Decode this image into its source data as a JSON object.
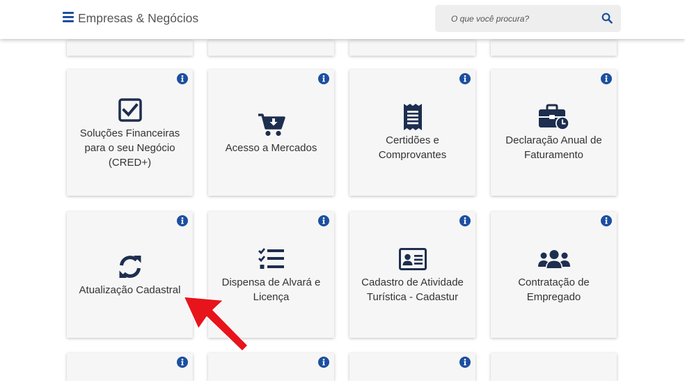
{
  "header": {
    "title": "Empresas & Negócios",
    "menu_icon": "hamburger-menu-icon",
    "search": {
      "placeholder": "O que você procura?",
      "value": "",
      "icon": "search-icon"
    }
  },
  "colors": {
    "accent": "#1c4fa0",
    "icon_dark": "#1d2e4f",
    "card_bg": "#f6f6f6",
    "search_bg": "#eeeeee",
    "annotation_arrow": "#e8141c"
  },
  "cards": [
    {
      "label": "Soluções Financeiras para o seu Negócio (CRED+)",
      "icon": "checkbox-icon"
    },
    {
      "label": "Acesso a Mercados",
      "icon": "shopping-cart-icon"
    },
    {
      "label": "Certidões e Comprovantes",
      "icon": "receipt-icon"
    },
    {
      "label": "Declaração Anual de Faturamento",
      "icon": "briefcase-clock-icon"
    },
    {
      "label": "Atualização Cadastral",
      "icon": "sync-icon"
    },
    {
      "label": "Dispensa de Alvará e Licença",
      "icon": "checklist-icon"
    },
    {
      "label": "Cadastro de Atividade Turística - Cadastur",
      "icon": "id-card-icon"
    },
    {
      "label": "Contratação de Empregado",
      "icon": "users-icon"
    }
  ],
  "info_icon": "info-circle-icon",
  "annotation": {
    "icon": "red-arrow-pointer-icon",
    "points_to": "Atualização Cadastral"
  }
}
